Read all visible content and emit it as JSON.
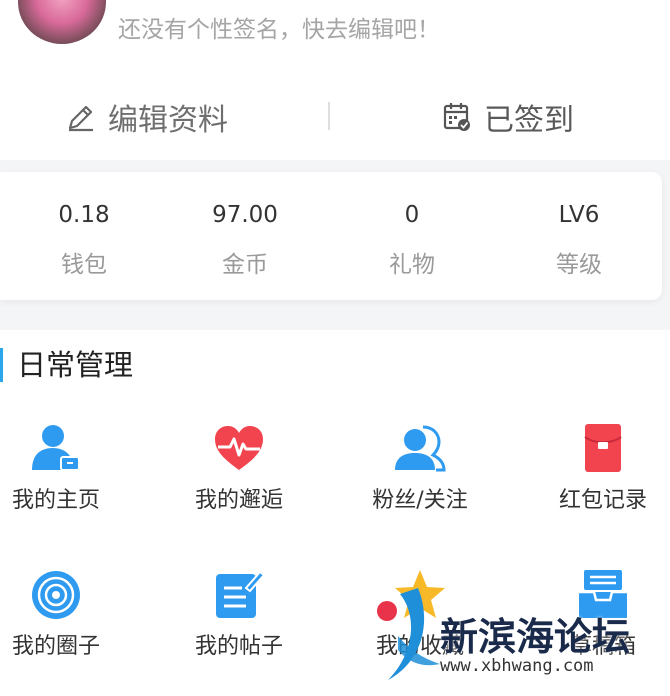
{
  "profile": {
    "signature": "还没有个性签名，快去编辑吧！"
  },
  "actions": {
    "edit_label": "编辑资料",
    "signed_label": "已签到"
  },
  "stats": [
    {
      "value": "0.18",
      "label": "钱包"
    },
    {
      "value": "97.00",
      "label": "金币"
    },
    {
      "value": "0",
      "label": "礼物"
    },
    {
      "value": "LV6",
      "label": "等级"
    }
  ],
  "daily": {
    "title": "日常管理",
    "items": [
      {
        "label": "我的主页",
        "icon": "user-home-icon"
      },
      {
        "label": "我的邂逅",
        "icon": "heartbeat-icon"
      },
      {
        "label": "粉丝/关注",
        "icon": "fans-icon"
      },
      {
        "label": "红包记录",
        "icon": "red-envelope-icon"
      },
      {
        "label": "我的圈子",
        "icon": "circle-icon"
      },
      {
        "label": "我的帖子",
        "icon": "post-edit-icon"
      },
      {
        "label": "我的收藏",
        "icon": "star-icon"
      },
      {
        "label": "草稿箱",
        "icon": "draft-box-icon"
      }
    ]
  },
  "watermark": {
    "name": "新滨海论坛",
    "url": "www.xbhwang.com"
  },
  "colors": {
    "accent": "#2aa6ea",
    "icon_blue": "#2e9bf0",
    "icon_red": "#f2444f"
  }
}
